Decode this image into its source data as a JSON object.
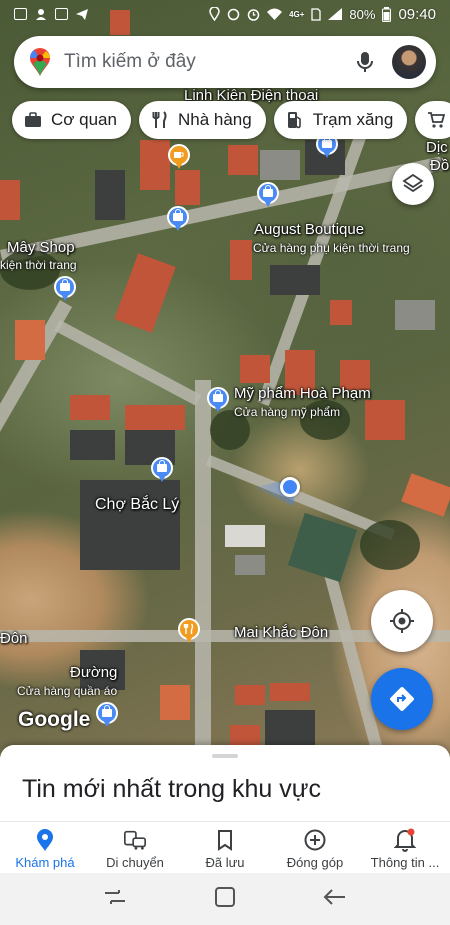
{
  "status_bar": {
    "battery": "80%",
    "time": "09:40",
    "network": "4G+"
  },
  "search": {
    "placeholder": "Tìm kiếm ở đây"
  },
  "chips": [
    {
      "label": "Cơ quan",
      "icon": "briefcase-icon"
    },
    {
      "label": "Nhà hàng",
      "icon": "restaurant-icon"
    },
    {
      "label": "Trạm xăng",
      "icon": "gas-station-icon"
    },
    {
      "label": "",
      "icon": "shopping-cart-icon"
    }
  ],
  "map": {
    "labels": {
      "linh_kien": "Linh Kiện Điện thoại",
      "dich": "Dịc",
      "do": "Đồ",
      "may_shop": "Mây Shop",
      "may_shop_sub": "kiện thời trang",
      "august": "August Boutique",
      "august_sub": "Cửa hàng phụ kiện thời trang",
      "my_pham": "Mỹ phẩm Hoà Phạm",
      "my_pham_sub": "Cửa hàng mỹ phẩm",
      "cho_bac_ly": "Chợ Bắc Lý",
      "mai_khac_don": "Mai Khắc Đôn",
      "don": "Đôn",
      "duong": "Đường",
      "duong_sub": "Cửa hàng quần áo"
    },
    "logo": "Google"
  },
  "sheet": {
    "title": "Tin mới nhất trong khu vực"
  },
  "bottom_nav": [
    {
      "label": "Khám phá",
      "icon": "explore-pin-icon",
      "active": true
    },
    {
      "label": "Di chuyển",
      "icon": "commute-icon",
      "active": false
    },
    {
      "label": "Đã lưu",
      "icon": "bookmark-icon",
      "active": false
    },
    {
      "label": "Đóng góp",
      "icon": "add-circle-icon",
      "active": false
    },
    {
      "label": "Thông tin ...",
      "icon": "bell-icon",
      "active": false
    }
  ],
  "colors": {
    "accent": "#1a73e8",
    "shop_pin": "#4a8af4",
    "food_pin": "#f29c1f",
    "notification_dot": "#ea4335"
  }
}
